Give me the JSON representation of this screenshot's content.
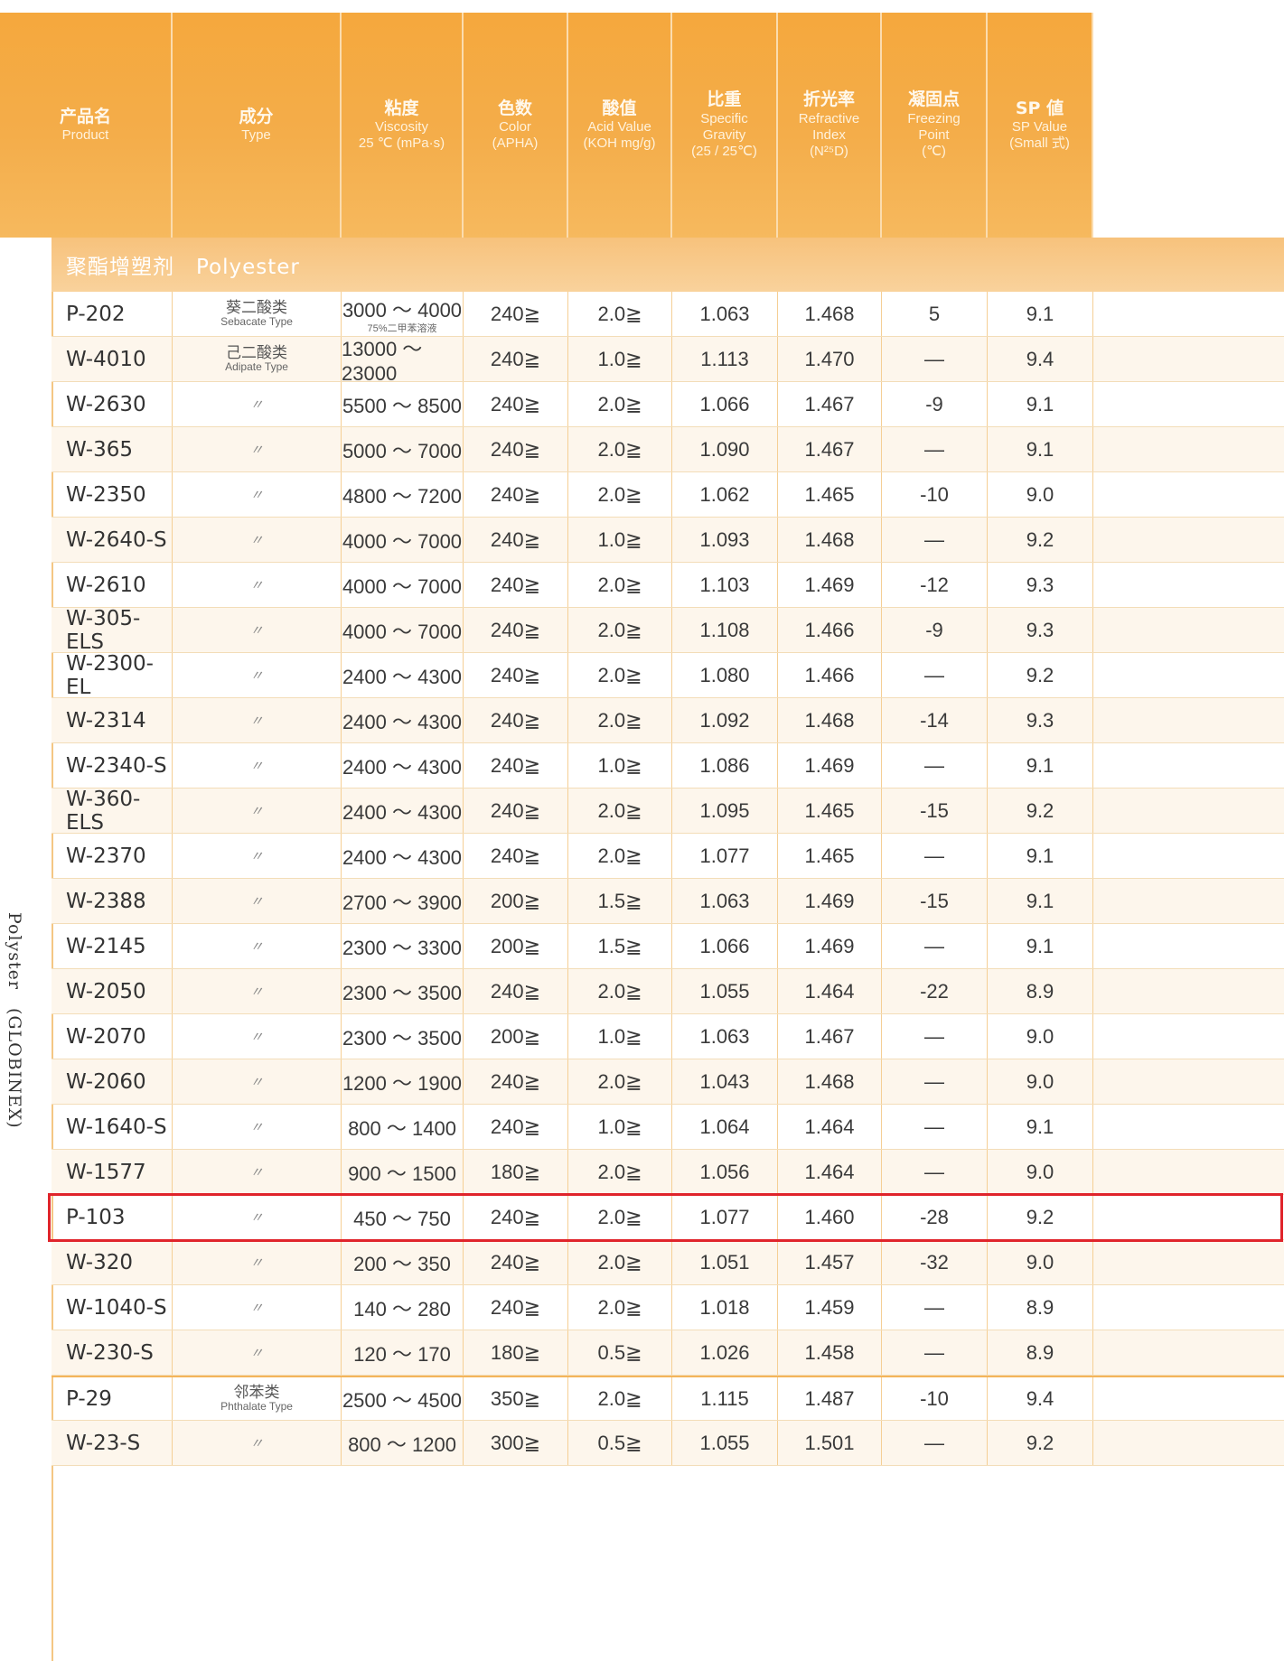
{
  "headers": [
    {
      "zh": "产品名",
      "en": "Product"
    },
    {
      "zh": "成分",
      "en": "Type"
    },
    {
      "zh": "粘度",
      "en": "Viscosity",
      "en2": "25 ℃ (mPa·s)"
    },
    {
      "zh": "色数",
      "en": "Color",
      "en2": "(APHA)"
    },
    {
      "zh": "酸值",
      "en": "Acid Value",
      "en2": "(KOH mg/g)"
    },
    {
      "zh": "比重",
      "en": "Specific",
      "en2": "Gravity",
      "en3": "(25 / 25℃)"
    },
    {
      "zh": "折光率",
      "en": "Refractive",
      "en2": "Index",
      "en3": "(N²⁵D)"
    },
    {
      "zh": "凝固点",
      "en": "Freezing",
      "en2": "Point",
      "en3": "(℃)"
    },
    {
      "zh": "SP 値",
      "en": "SP Value",
      "en2": "(Small 式)"
    }
  ],
  "side_label": "Polyster　(GLOBINEX)",
  "section_title": "聚酯增塑剂　Polyester",
  "rows": [
    {
      "product": "P-202",
      "type_zh": "葵二酸类",
      "type_en": "Sebacate Type",
      "viscosity": "3000 ～ 4000",
      "visc_note": "75%二甲苯溶液",
      "color": "240≧",
      "acid": "2.0≧",
      "gravity": "1.063",
      "refr": "1.468",
      "freeze": "5",
      "sp": "9.1"
    },
    {
      "product": "W-4010",
      "type_zh": "己二酸类",
      "type_en": "Adipate Type",
      "viscosity": "13000 ～ 23000",
      "color": "240≧",
      "acid": "1.0≧",
      "gravity": "1.113",
      "refr": "1.470",
      "freeze": "—",
      "sp": "9.4"
    },
    {
      "product": "W-2630",
      "type": "〃",
      "viscosity": "5500 ～ 8500",
      "color": "240≧",
      "acid": "2.0≧",
      "gravity": "1.066",
      "refr": "1.467",
      "freeze": "-9",
      "sp": "9.1"
    },
    {
      "product": "W-365",
      "type": "〃",
      "viscosity": "5000 ～ 7000",
      "color": "240≧",
      "acid": "2.0≧",
      "gravity": "1.090",
      "refr": "1.467",
      "freeze": "—",
      "sp": "9.1"
    },
    {
      "product": "W-2350",
      "type": "〃",
      "viscosity": "4800 ～ 7200",
      "color": "240≧",
      "acid": "2.0≧",
      "gravity": "1.062",
      "refr": "1.465",
      "freeze": "-10",
      "sp": "9.0"
    },
    {
      "product": "W-2640-S",
      "type": "〃",
      "viscosity": "4000 ～ 7000",
      "color": "240≧",
      "acid": "1.0≧",
      "gravity": "1.093",
      "refr": "1.468",
      "freeze": "—",
      "sp": "9.2"
    },
    {
      "product": "W-2610",
      "type": "〃",
      "viscosity": "4000 ～ 7000",
      "color": "240≧",
      "acid": "2.0≧",
      "gravity": "1.103",
      "refr": "1.469",
      "freeze": "-12",
      "sp": "9.3"
    },
    {
      "product": "W-305-ELS",
      "type": "〃",
      "viscosity": "4000 ～ 7000",
      "color": "240≧",
      "acid": "2.0≧",
      "gravity": "1.108",
      "refr": "1.466",
      "freeze": "-9",
      "sp": "9.3"
    },
    {
      "product": "W-2300-EL",
      "type": "〃",
      "viscosity": "2400 ～ 4300",
      "color": "240≧",
      "acid": "2.0≧",
      "gravity": "1.080",
      "refr": "1.466",
      "freeze": "—",
      "sp": "9.2"
    },
    {
      "product": "W-2314",
      "type": "〃",
      "viscosity": "2400 ～ 4300",
      "color": "240≧",
      "acid": "2.0≧",
      "gravity": "1.092",
      "refr": "1.468",
      "freeze": "-14",
      "sp": "9.3"
    },
    {
      "product": "W-2340-S",
      "type": "〃",
      "viscosity": "2400 ～ 4300",
      "color": "240≧",
      "acid": "1.0≧",
      "gravity": "1.086",
      "refr": "1.469",
      "freeze": "—",
      "sp": "9.1"
    },
    {
      "product": "W-360-ELS",
      "type": "〃",
      "viscosity": "2400 ～ 4300",
      "color": "240≧",
      "acid": "2.0≧",
      "gravity": "1.095",
      "refr": "1.465",
      "freeze": "-15",
      "sp": "9.2"
    },
    {
      "product": "W-2370",
      "type": "〃",
      "viscosity": "2400 ～ 4300",
      "color": "240≧",
      "acid": "2.0≧",
      "gravity": "1.077",
      "refr": "1.465",
      "freeze": "—",
      "sp": "9.1"
    },
    {
      "product": "W-2388",
      "type": "〃",
      "viscosity": "2700 ～ 3900",
      "color": "200≧",
      "acid": "1.5≧",
      "gravity": "1.063",
      "refr": "1.469",
      "freeze": "-15",
      "sp": "9.1"
    },
    {
      "product": "W-2145",
      "type": "〃",
      "viscosity": "2300 ～ 3300",
      "color": "200≧",
      "acid": "1.5≧",
      "gravity": "1.066",
      "refr": "1.469",
      "freeze": "—",
      "sp": "9.1"
    },
    {
      "product": "W-2050",
      "type": "〃",
      "viscosity": "2300 ～ 3500",
      "color": "240≧",
      "acid": "2.0≧",
      "gravity": "1.055",
      "refr": "1.464",
      "freeze": "-22",
      "sp": "8.9"
    },
    {
      "product": "W-2070",
      "type": "〃",
      "viscosity": "2300 ～ 3500",
      "color": "200≧",
      "acid": "1.0≧",
      "gravity": "1.063",
      "refr": "1.467",
      "freeze": "—",
      "sp": "9.0"
    },
    {
      "product": "W-2060",
      "type": "〃",
      "viscosity": "1200 ～ 1900",
      "color": "240≧",
      "acid": "2.0≧",
      "gravity": "1.043",
      "refr": "1.468",
      "freeze": "—",
      "sp": "9.0"
    },
    {
      "product": "W-1640-S",
      "type": "〃",
      "viscosity": "800 ～ 1400",
      "color": "240≧",
      "acid": "1.0≧",
      "gravity": "1.064",
      "refr": "1.464",
      "freeze": "—",
      "sp": "9.1"
    },
    {
      "product": "W-1577",
      "type": "〃",
      "viscosity": "900 ～ 1500",
      "color": "180≧",
      "acid": "2.0≧",
      "gravity": "1.056",
      "refr": "1.464",
      "freeze": "—",
      "sp": "9.0"
    },
    {
      "product": "P-103",
      "type": "〃",
      "viscosity": "450 ～ 750",
      "color": "240≧",
      "acid": "2.0≧",
      "gravity": "1.077",
      "refr": "1.460",
      "freeze": "-28",
      "sp": "9.2",
      "highlighted": true
    },
    {
      "product": "W-320",
      "type": "〃",
      "viscosity": "200 ～ 350",
      "color": "240≧",
      "acid": "2.0≧",
      "gravity": "1.051",
      "refr": "1.457",
      "freeze": "-32",
      "sp": "9.0"
    },
    {
      "product": "W-1040-S",
      "type": "〃",
      "viscosity": "140 ～ 280",
      "color": "240≧",
      "acid": "2.0≧",
      "gravity": "1.018",
      "refr": "1.459",
      "freeze": "—",
      "sp": "8.9"
    },
    {
      "product": "W-230-S",
      "type": "〃",
      "viscosity": "120 ～ 170",
      "color": "180≧",
      "acid": "0.5≧",
      "gravity": "1.026",
      "refr": "1.458",
      "freeze": "—",
      "sp": "8.9"
    },
    {
      "product": "P-29",
      "type_zh": "邻苯类",
      "type_en": "Phthalate Type",
      "viscosity": "2500 ～ 4500",
      "color": "350≧",
      "acid": "2.0≧",
      "gravity": "1.115",
      "refr": "1.487",
      "freeze": "-10",
      "sp": "9.4",
      "group_start": true
    },
    {
      "product": "W-23-S",
      "type": "〃",
      "viscosity": "800 ～ 1200",
      "color": "300≧",
      "acid": "0.5≧",
      "gravity": "1.055",
      "refr": "1.501",
      "freeze": "—",
      "sp": "9.2"
    }
  ],
  "colors": {
    "header_orange": "#f5a83d",
    "section_band": "#f8c98a",
    "highlight_border": "#e0242b"
  }
}
